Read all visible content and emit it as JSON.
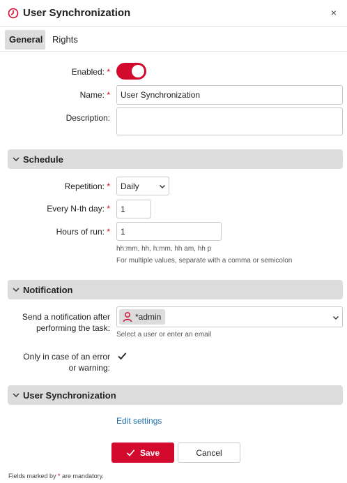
{
  "header": {
    "title": "User Synchronization",
    "close": "×"
  },
  "tabs": [
    {
      "label": "General"
    },
    {
      "label": "Rights"
    }
  ],
  "general": {
    "enabled_label": "Enabled:",
    "enabled": true,
    "name_label": "Name:",
    "name_value": "User Synchronization",
    "description_label": "Description:",
    "description_value": ""
  },
  "schedule": {
    "title": "Schedule",
    "repetition_label": "Repetition:",
    "repetition_value": "Daily",
    "every_label": "Every N-th day:",
    "every_value": "1",
    "hours_label": "Hours of run:",
    "hours_value": "1",
    "hint1": "hh:mm, hh, h:mm, hh am, hh p",
    "hint2": "For multiple values, separate with a comma or semicolon"
  },
  "notification": {
    "title": "Notification",
    "send_label_line1": "Send a notification after",
    "send_label_line2": "performing the task:",
    "recipient": "*admin",
    "recipient_hint": "Select a user or enter an email",
    "error_label_line1": "Only in case of an error",
    "error_label_line2": "or warning:",
    "only_error": true
  },
  "user_sync": {
    "title": "User Synchronization",
    "edit_link": "Edit settings"
  },
  "actions": {
    "save": "Save",
    "cancel": "Cancel"
  },
  "footer": {
    "note_prefix": "Fields marked by ",
    "note_star": "*",
    "note_suffix": " are mandatory."
  },
  "colors": {
    "accent": "#d20a2e",
    "link": "#1a6faf",
    "section_bg": "#dcdcdc"
  }
}
